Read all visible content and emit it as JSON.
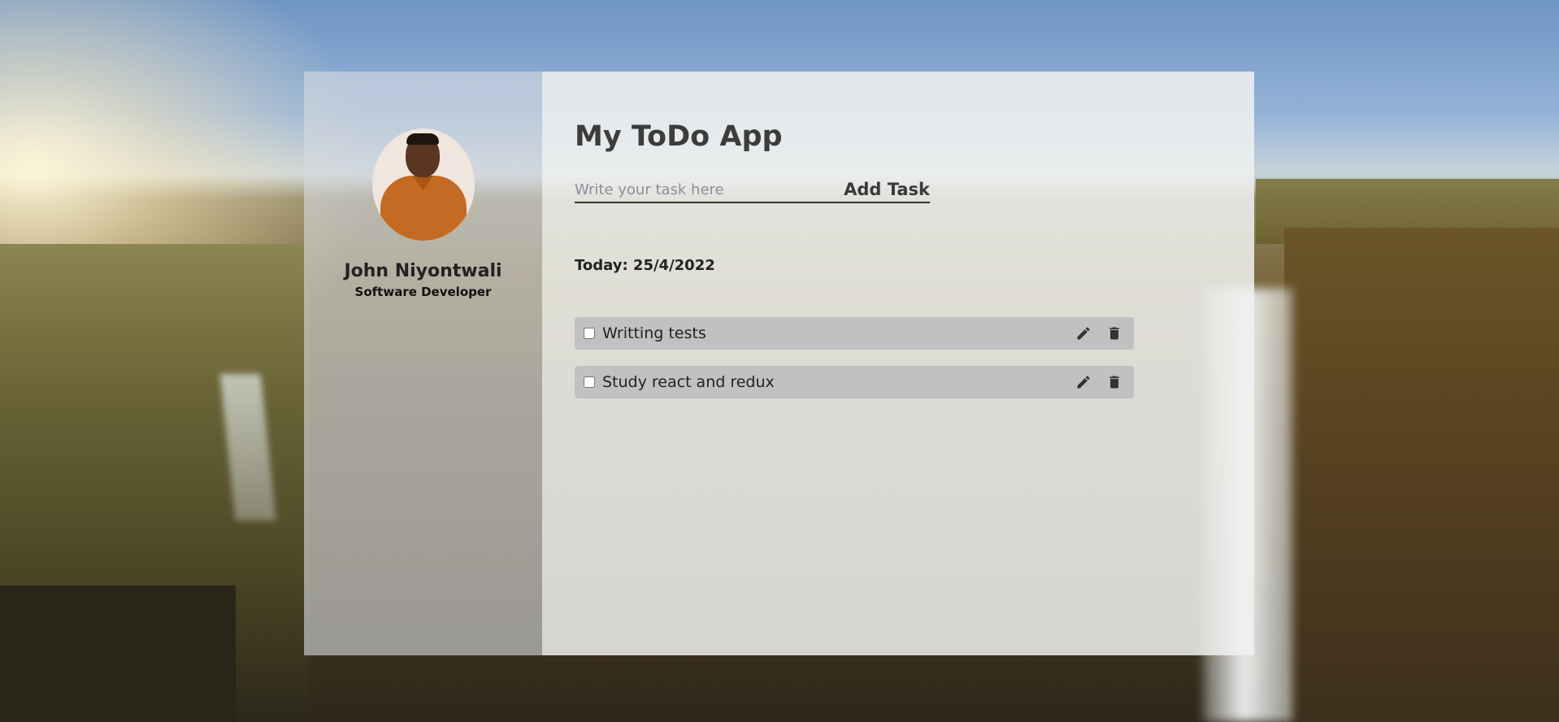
{
  "profile": {
    "name": "John Niyontwali",
    "role": "Software Developer"
  },
  "app": {
    "title": "My ToDo App"
  },
  "add_task": {
    "placeholder": "Write your task here",
    "value": "",
    "button_label": "Add Task"
  },
  "today": {
    "label": "Today: 25/4/2022"
  },
  "tasks": [
    {
      "label": "Writting tests",
      "checked": false
    },
    {
      "label": "Study react and redux",
      "checked": false
    }
  ],
  "icons": {
    "edit": "pencil-icon",
    "delete": "trash-icon"
  },
  "colors": {
    "sidebar_bg": "#d7dade",
    "main_bg": "#f0f1f0",
    "task_bg": "#afb1b4",
    "text_dark": "#222222"
  }
}
